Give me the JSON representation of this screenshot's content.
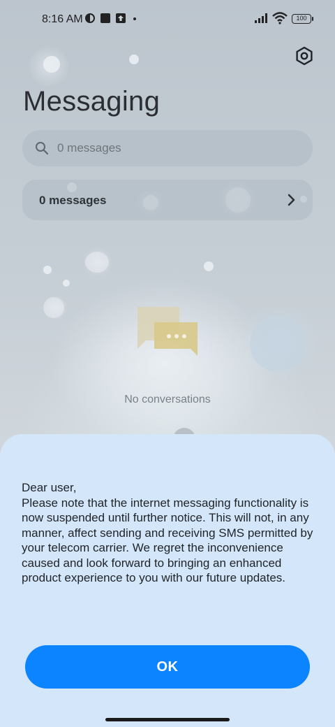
{
  "status_bar": {
    "time": "8:16 AM",
    "battery_level": "100",
    "icons": [
      "vpn-icon",
      "app-notification-icon",
      "upload-icon",
      "dot-icon",
      "signal-icon",
      "wifi-icon",
      "battery-icon"
    ]
  },
  "header": {
    "title": "Messaging",
    "settings_icon": "settings-icon"
  },
  "search": {
    "placeholder": "0 messages",
    "icon": "search-icon"
  },
  "messages_row": {
    "label": "0 messages",
    "icon": "chevron-right-icon"
  },
  "empty_state": {
    "icon": "chat-bubbles-icon",
    "text": "No conversations"
  },
  "dialog": {
    "message": "Dear user,\nPlease note that the internet messaging functionality is now suspended until further notice. This will not, in any manner, affect sending and receiving SMS permitted by your telecom carrier. We regret the inconvenience caused and look forward to bringing an enhanced product experience to you with our future updates.",
    "ok_label": "OK"
  },
  "colors": {
    "accent": "#0d84ff",
    "dialog_background": "#d4e6f9"
  }
}
